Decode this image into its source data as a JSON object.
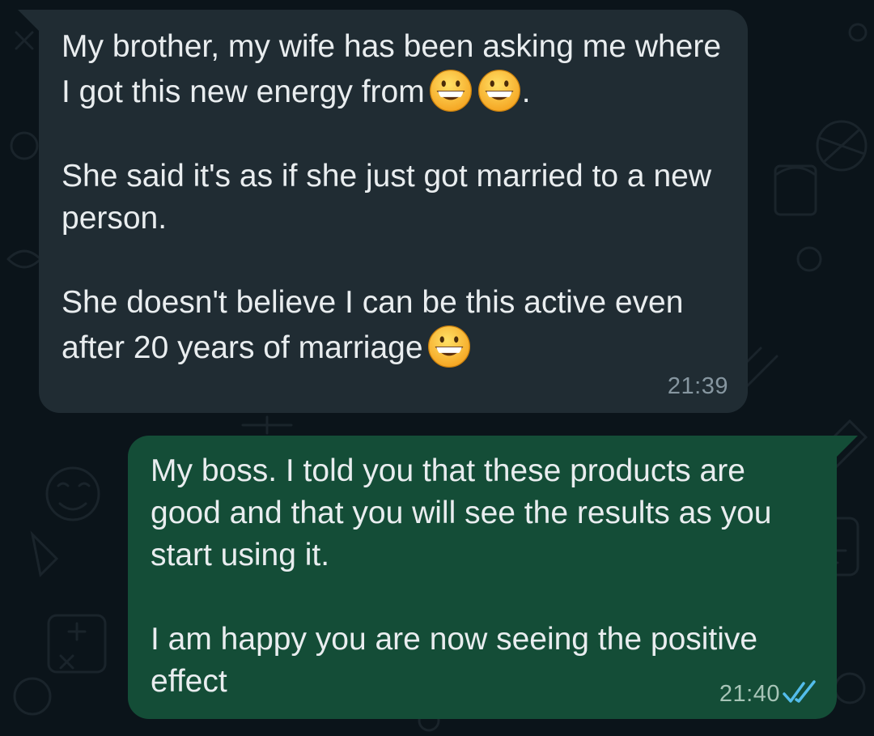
{
  "conversation": {
    "messages": [
      {
        "direction": "incoming",
        "paragraphs": [
          {
            "text": "My brother, my wife has been asking me where I got this new energy from",
            "emojis": [
              "grinning-face-emoji",
              "grinning-face-emoji"
            ],
            "suffix": "."
          },
          {
            "text": "She said it's as if she just got married to a new person."
          },
          {
            "text": "She doesn't believe I can be this active even after 20 years of marriage",
            "emojis": [
              "grinning-face-emoji"
            ]
          }
        ],
        "time": "21:39"
      },
      {
        "direction": "outgoing",
        "paragraphs": [
          {
            "text": "My boss. I told you that these products are good and that you will see the results as you start using it."
          },
          {
            "text": "I am happy you are now seeing the positive effect"
          }
        ],
        "time": "21:40",
        "status_icon": "double-check-read-icon"
      }
    ]
  },
  "colors": {
    "background": "#0b141a",
    "incoming_bubble": "#202c33",
    "outgoing_bubble": "#144d37",
    "text": "#e9edef",
    "read_ticks": "#53bdeb"
  }
}
